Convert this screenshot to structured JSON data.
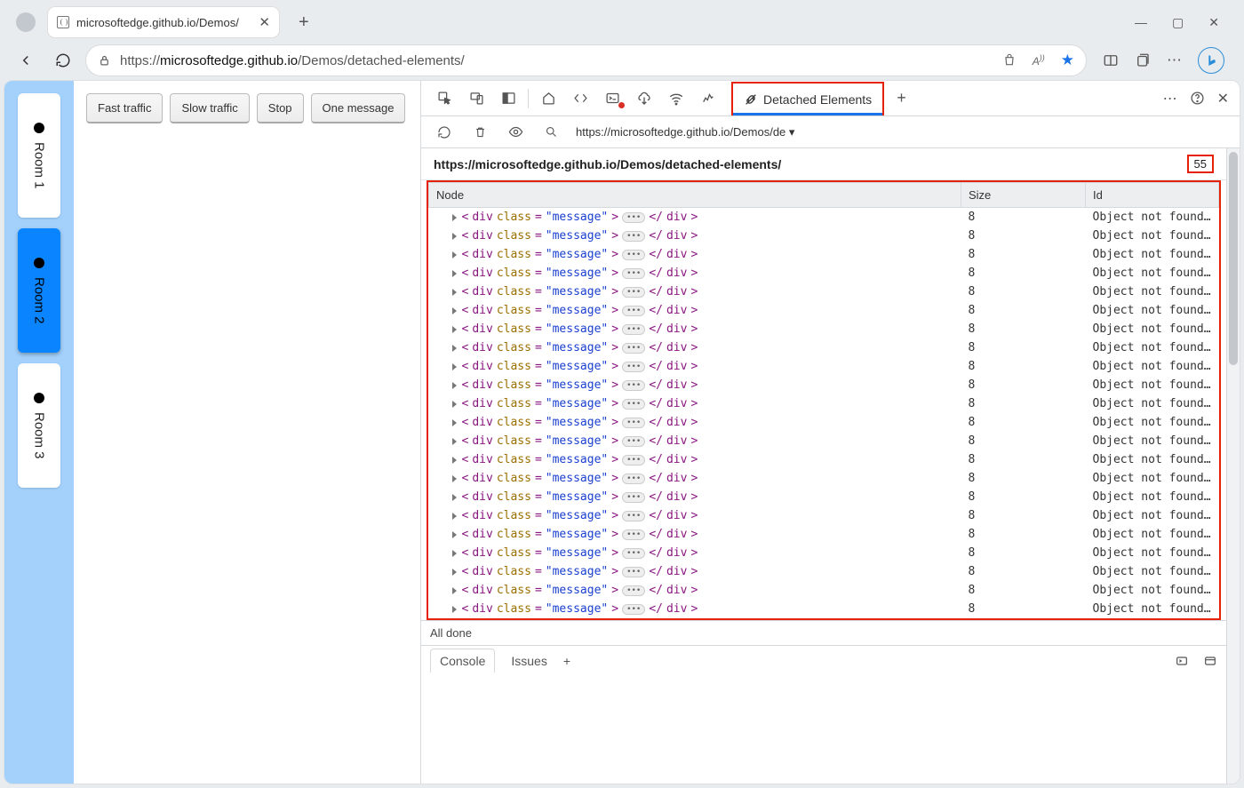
{
  "browser": {
    "tab_title": "microsoftedge.github.io/Demos/",
    "url_display": {
      "prefix": "https://",
      "host": "microsoftedge.github.io",
      "path": "/Demos/detached-elements/"
    }
  },
  "page": {
    "rooms": [
      "Room 1",
      "Room 2",
      "Room 3"
    ],
    "active_room_index": 1,
    "buttons": [
      "Fast traffic",
      "Slow traffic",
      "Stop",
      "One message"
    ]
  },
  "devtools": {
    "active_tab": "Detached Elements",
    "origin_url": "https://microsoftedge.github.io/Demos/de",
    "panel_origin": "https://microsoftedge.github.io/Demos/detached-elements/",
    "count": "55",
    "columns": {
      "node": "Node",
      "size": "Size",
      "id": "Id"
    },
    "row_template": {
      "tag": "div",
      "attr_name": "class",
      "attr_value": "\"message\"",
      "size": "8",
      "id_text": "Object not found i..."
    },
    "row_count": 22,
    "status": "All done",
    "drawer": {
      "console": "Console",
      "issues": "Issues"
    }
  }
}
